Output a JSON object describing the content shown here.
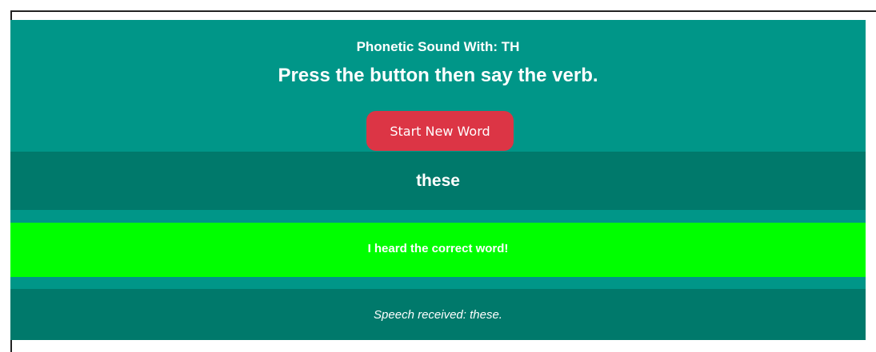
{
  "header": {
    "sound_title": "Phonetic Sound With: TH",
    "instruction": "Press the button then say the verb."
  },
  "controls": {
    "start_button_label": "Start New Word"
  },
  "word": {
    "current": "these"
  },
  "result": {
    "message": "I heard the correct word!"
  },
  "speech": {
    "received": "Speech received: these."
  },
  "colors": {
    "app_background": "#009688",
    "panel_dark": "#00796b",
    "success": "#00ff00",
    "button": "#dc3545",
    "text": "#ffffff"
  }
}
